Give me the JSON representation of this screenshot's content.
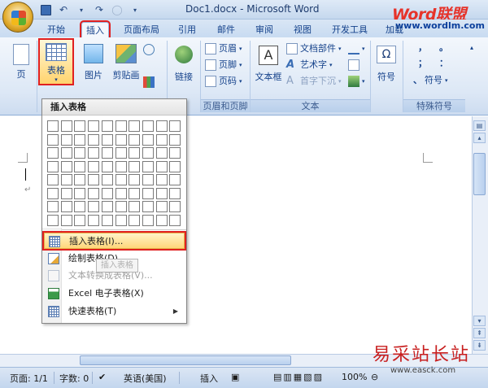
{
  "window": {
    "title": "Doc1.docx - Microsoft Word"
  },
  "quick_access": {
    "save": "save-icon",
    "undo": "↶",
    "redo": "↷",
    "sep": "▾"
  },
  "brand": {
    "logo": "Word联盟",
    "url": "www.wordlm.com"
  },
  "tabs": [
    {
      "label": "开始"
    },
    {
      "label": "插入"
    },
    {
      "label": "页面布局"
    },
    {
      "label": "引用"
    },
    {
      "label": "邮件"
    },
    {
      "label": "审阅"
    },
    {
      "label": "视图"
    },
    {
      "label": "开发工具"
    },
    {
      "label": "加载"
    }
  ],
  "ribbon": {
    "page": "页",
    "table": "表格",
    "picture": "图片",
    "clipart": "剪贴画",
    "link": "链接",
    "header": "页眉",
    "footer": "页脚",
    "pagenum": "页码",
    "group_header_footer": "页眉和页脚",
    "textbox": "文本框",
    "docparts": "文档部件",
    "wordart": "艺术字",
    "dropcap": "首字下沉",
    "group_text": "文本",
    "symbol": "符号",
    "special_symbol": "符号",
    "group_special": "特殊符号",
    "punct": [
      "，",
      "。",
      "；",
      "：",
      "、",
      "？"
    ]
  },
  "dropdown": {
    "header": "插入表格",
    "grid_cols": 10,
    "grid_rows": 8,
    "items": [
      {
        "label": "插入表格(I)...",
        "icon": "insert-table-icon"
      },
      {
        "label": "绘制表格(D)",
        "icon": "draw-table-icon"
      },
      {
        "label": "文本转换成表格(V)...",
        "icon": "convert-text-icon"
      },
      {
        "label": "Excel 电子表格(X)",
        "icon": "excel-icon"
      },
      {
        "label": "快速表格(T)",
        "icon": "quick-table-icon"
      }
    ],
    "tooltip": "插入表格"
  },
  "status": {
    "page": "页面: 1/1",
    "words": "字数: 0",
    "lang": "英语(美国)",
    "mode": "插入",
    "zoom": "100%"
  },
  "watermark": {
    "text": "易采站长站",
    "url": "www.easck.com"
  }
}
